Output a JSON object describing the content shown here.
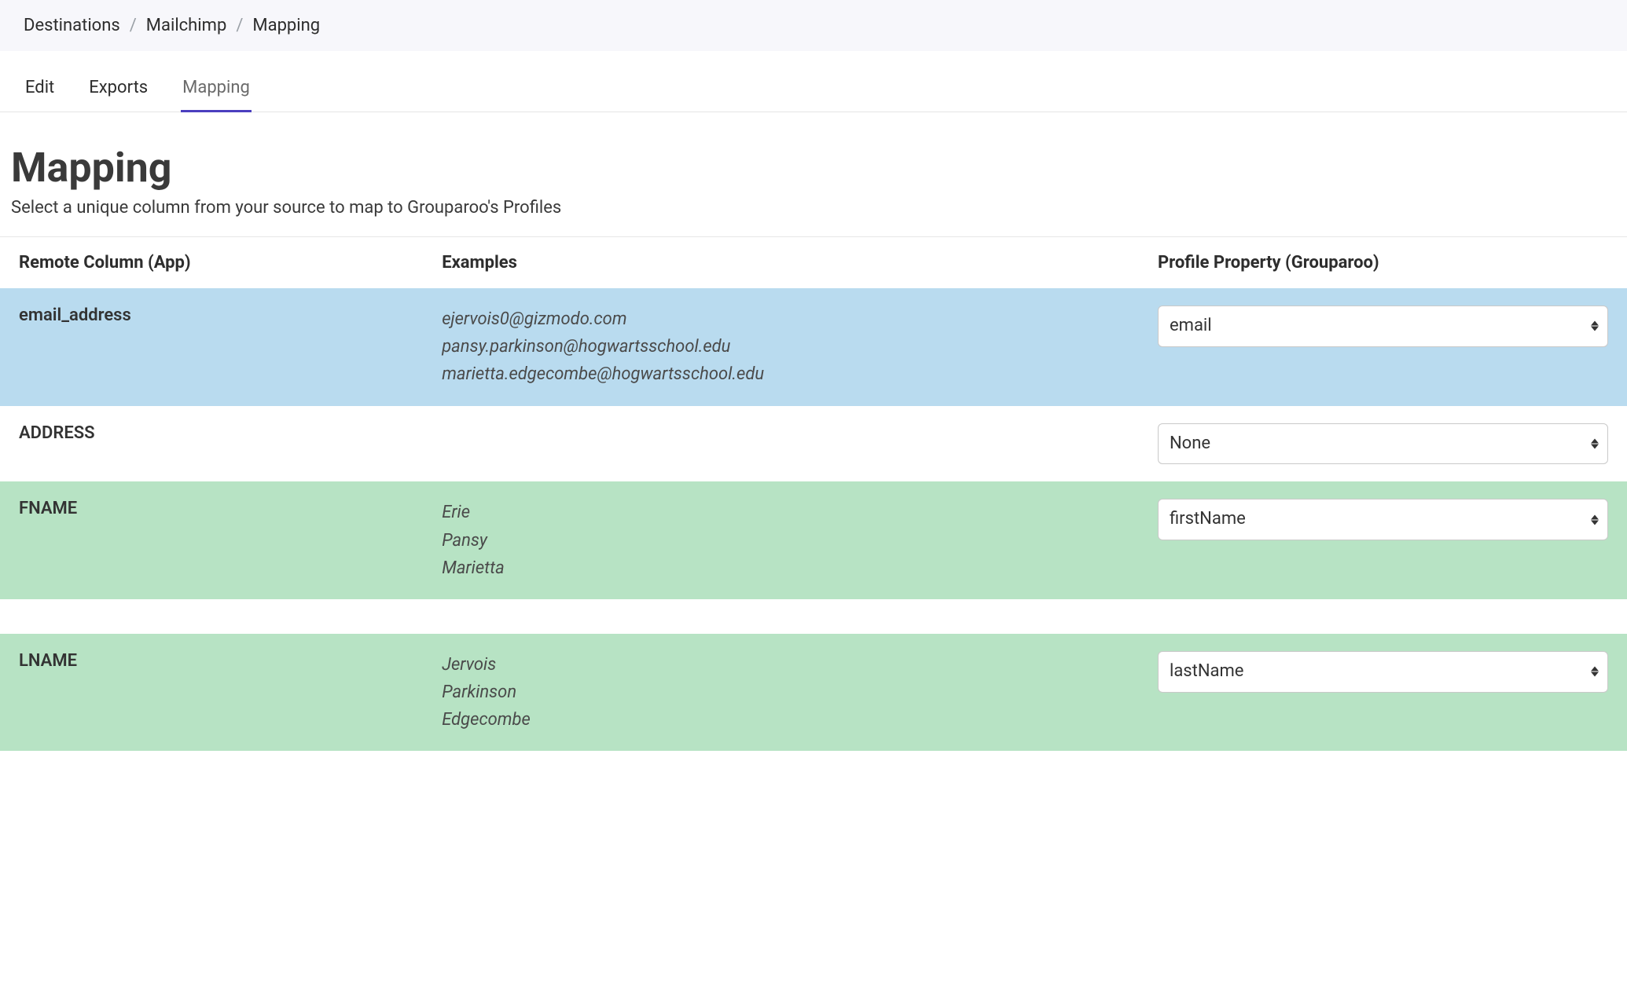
{
  "breadcrumb": {
    "items": [
      "Destinations",
      "Mailchimp",
      "Mapping"
    ]
  },
  "tabs": {
    "items": [
      {
        "label": "Edit",
        "active": false
      },
      {
        "label": "Exports",
        "active": false
      },
      {
        "label": "Mapping",
        "active": true
      }
    ]
  },
  "page": {
    "title": "Mapping",
    "subtitle": "Select a unique column from your source to map to Grouparoo's Profiles"
  },
  "table": {
    "headers": {
      "remote": "Remote Column (App)",
      "examples": "Examples",
      "property": "Profile Property (Grouparoo)"
    },
    "rows": [
      {
        "remote": "email_address",
        "examples": [
          "ejervois0@gizmodo.com",
          "pansy.parkinson@hogwartsschool.edu",
          "marietta.edgecombe@hogwartsschool.edu"
        ],
        "selected": "email",
        "rowClass": "row-blue"
      },
      {
        "remote": "ADDRESS",
        "examples": [],
        "selected": "None",
        "rowClass": "row-white"
      },
      {
        "remote": "FNAME",
        "examples": [
          "Erie",
          "Pansy",
          "Marietta"
        ],
        "selected": "firstName",
        "rowClass": "row-green"
      },
      {
        "remote": "LNAME",
        "examples": [
          "Jervois",
          "Parkinson",
          "Edgecombe"
        ],
        "selected": "lastName",
        "rowClass": "row-green"
      }
    ]
  }
}
